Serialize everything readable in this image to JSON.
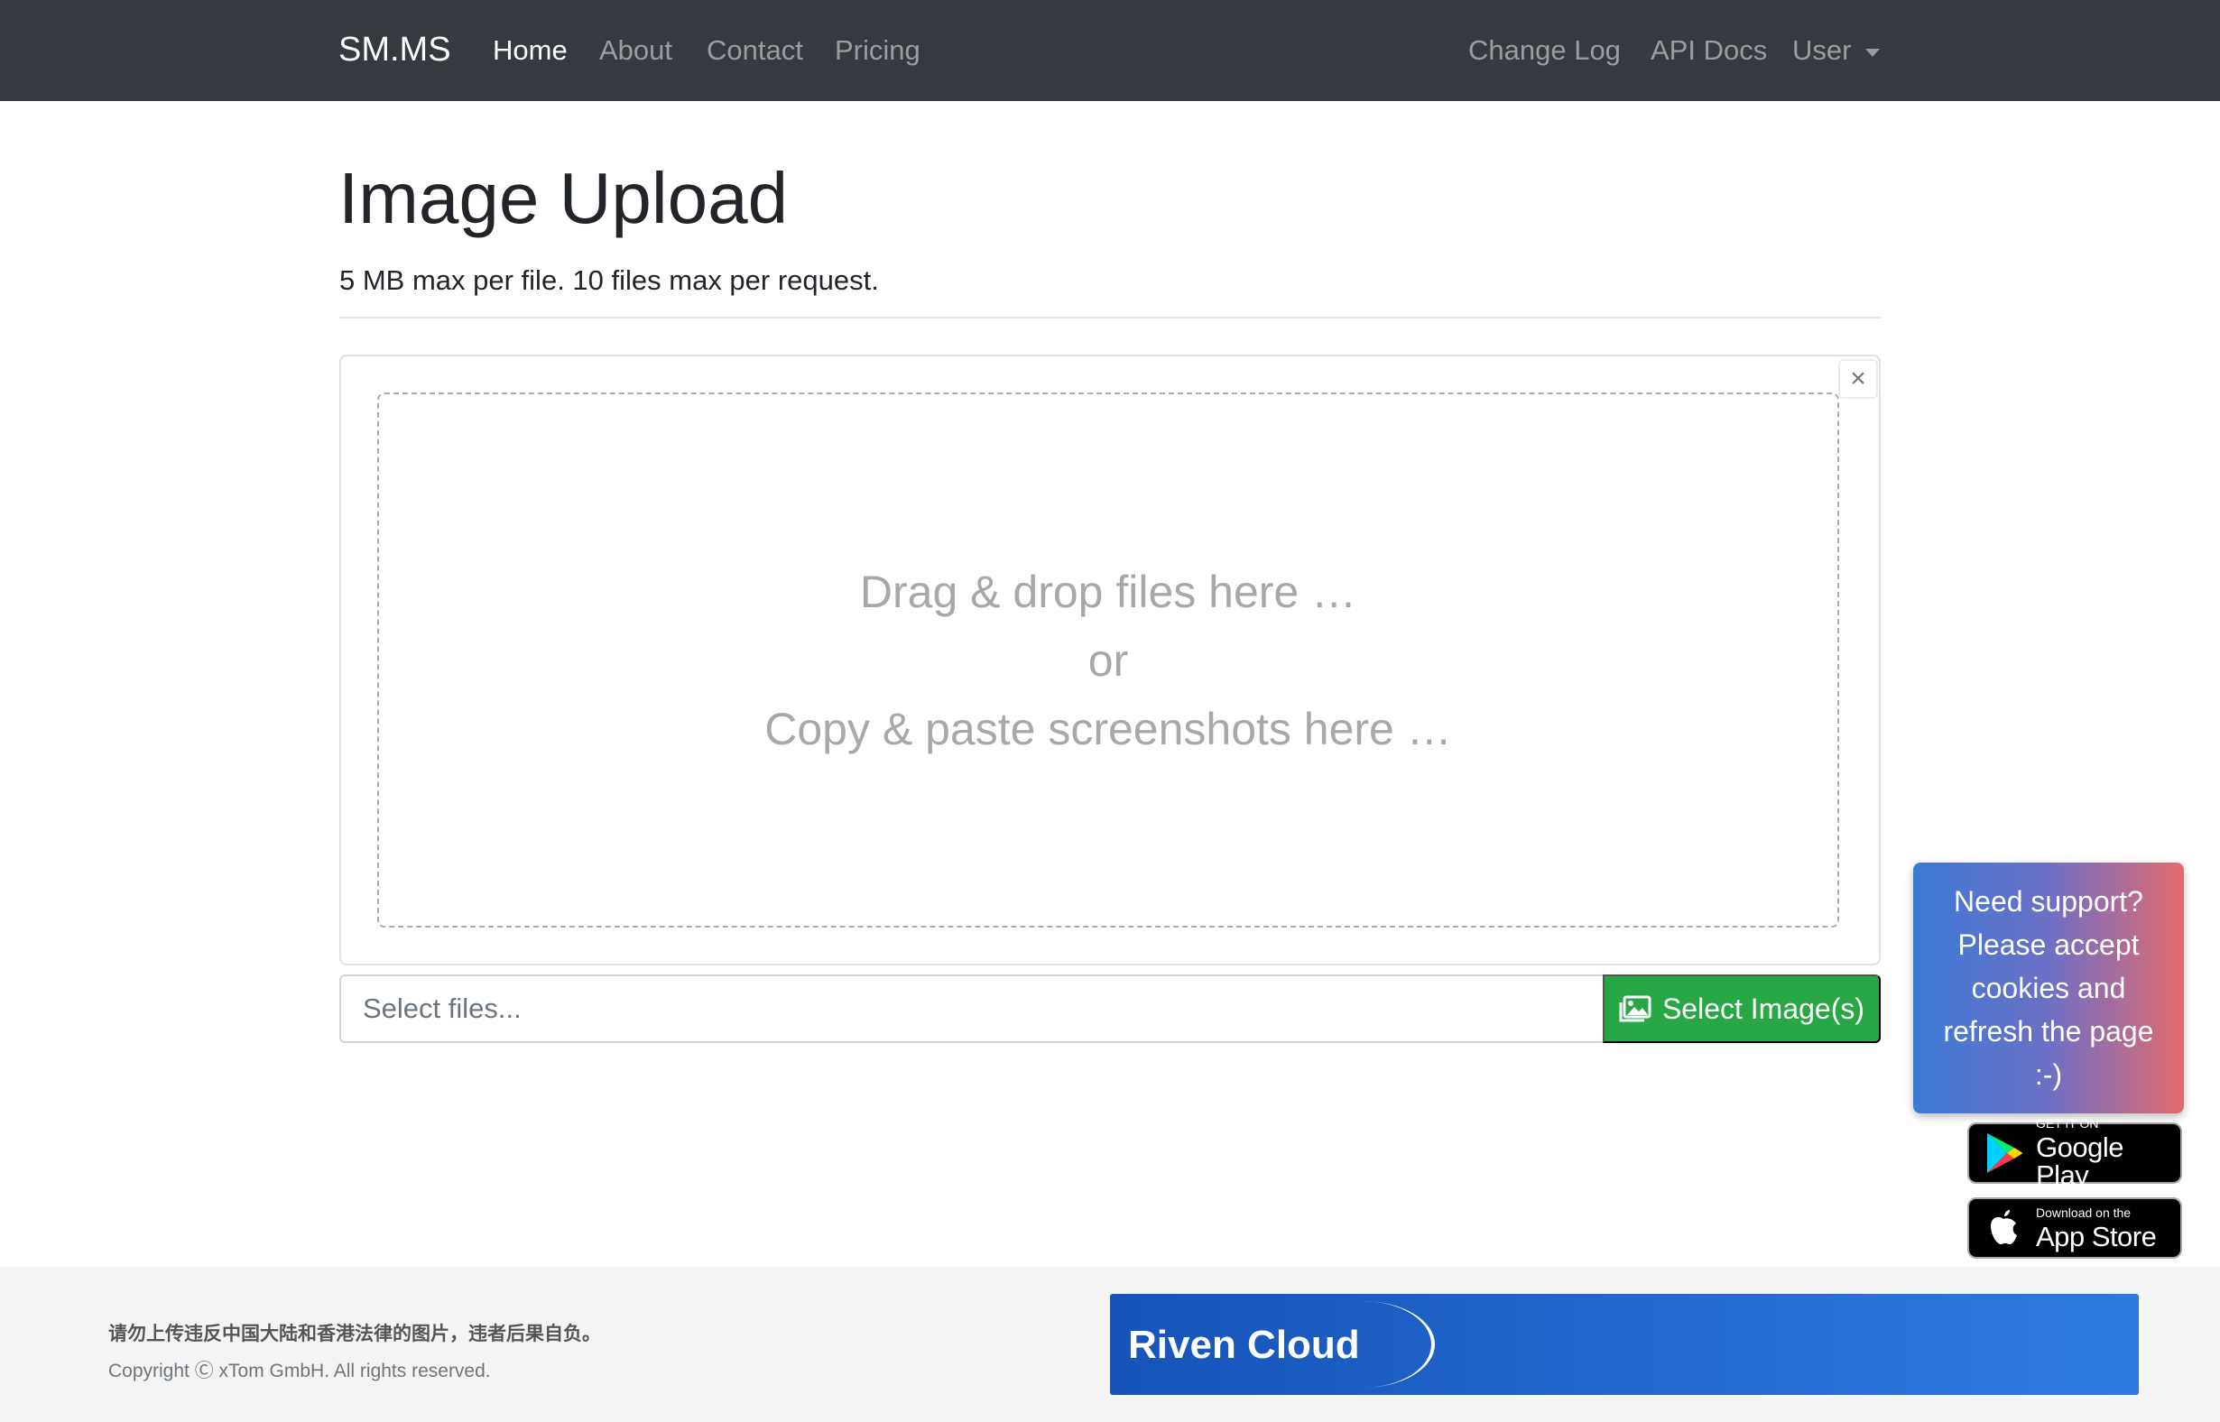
{
  "nav": {
    "brand": "SM.MS",
    "left_links": [
      "Home",
      "About",
      "Contact",
      "Pricing"
    ],
    "right_links": [
      "Change Log",
      "API Docs",
      "User"
    ]
  },
  "header": {
    "title": "Image Upload",
    "subtitle": "5 MB max per file. 10 files max per request."
  },
  "upload": {
    "close_label": "×",
    "drop_line1": "Drag & drop files here …",
    "drop_line2": "or",
    "drop_line3": "Copy & paste screenshots here …",
    "file_placeholder": "Select files...",
    "select_button": "Select Image(s)"
  },
  "support": {
    "text": "Need support? Please accept cookies and refresh the page :-)"
  },
  "badges": {
    "google_small": "GET IT ON",
    "google_big": "Google Play",
    "apple_small": "Download on the",
    "apple_big": "App Store"
  },
  "footer": {
    "warning": "请勿上传违反中国大陆和香港法律的图片，违者后果自负。",
    "copyright": "Copyright Ⓒ xTom GmbH. All rights reserved.",
    "ad_text": "Riven Cloud"
  },
  "colors": {
    "navbar_bg": "#343a40",
    "button_green": "#28a745",
    "footer_bg": "#f4f4f4",
    "ad_blue": "#1a5fc8"
  },
  "icons": [
    "caret-down-icon",
    "images-icon",
    "google-play-icon",
    "apple-icon"
  ]
}
